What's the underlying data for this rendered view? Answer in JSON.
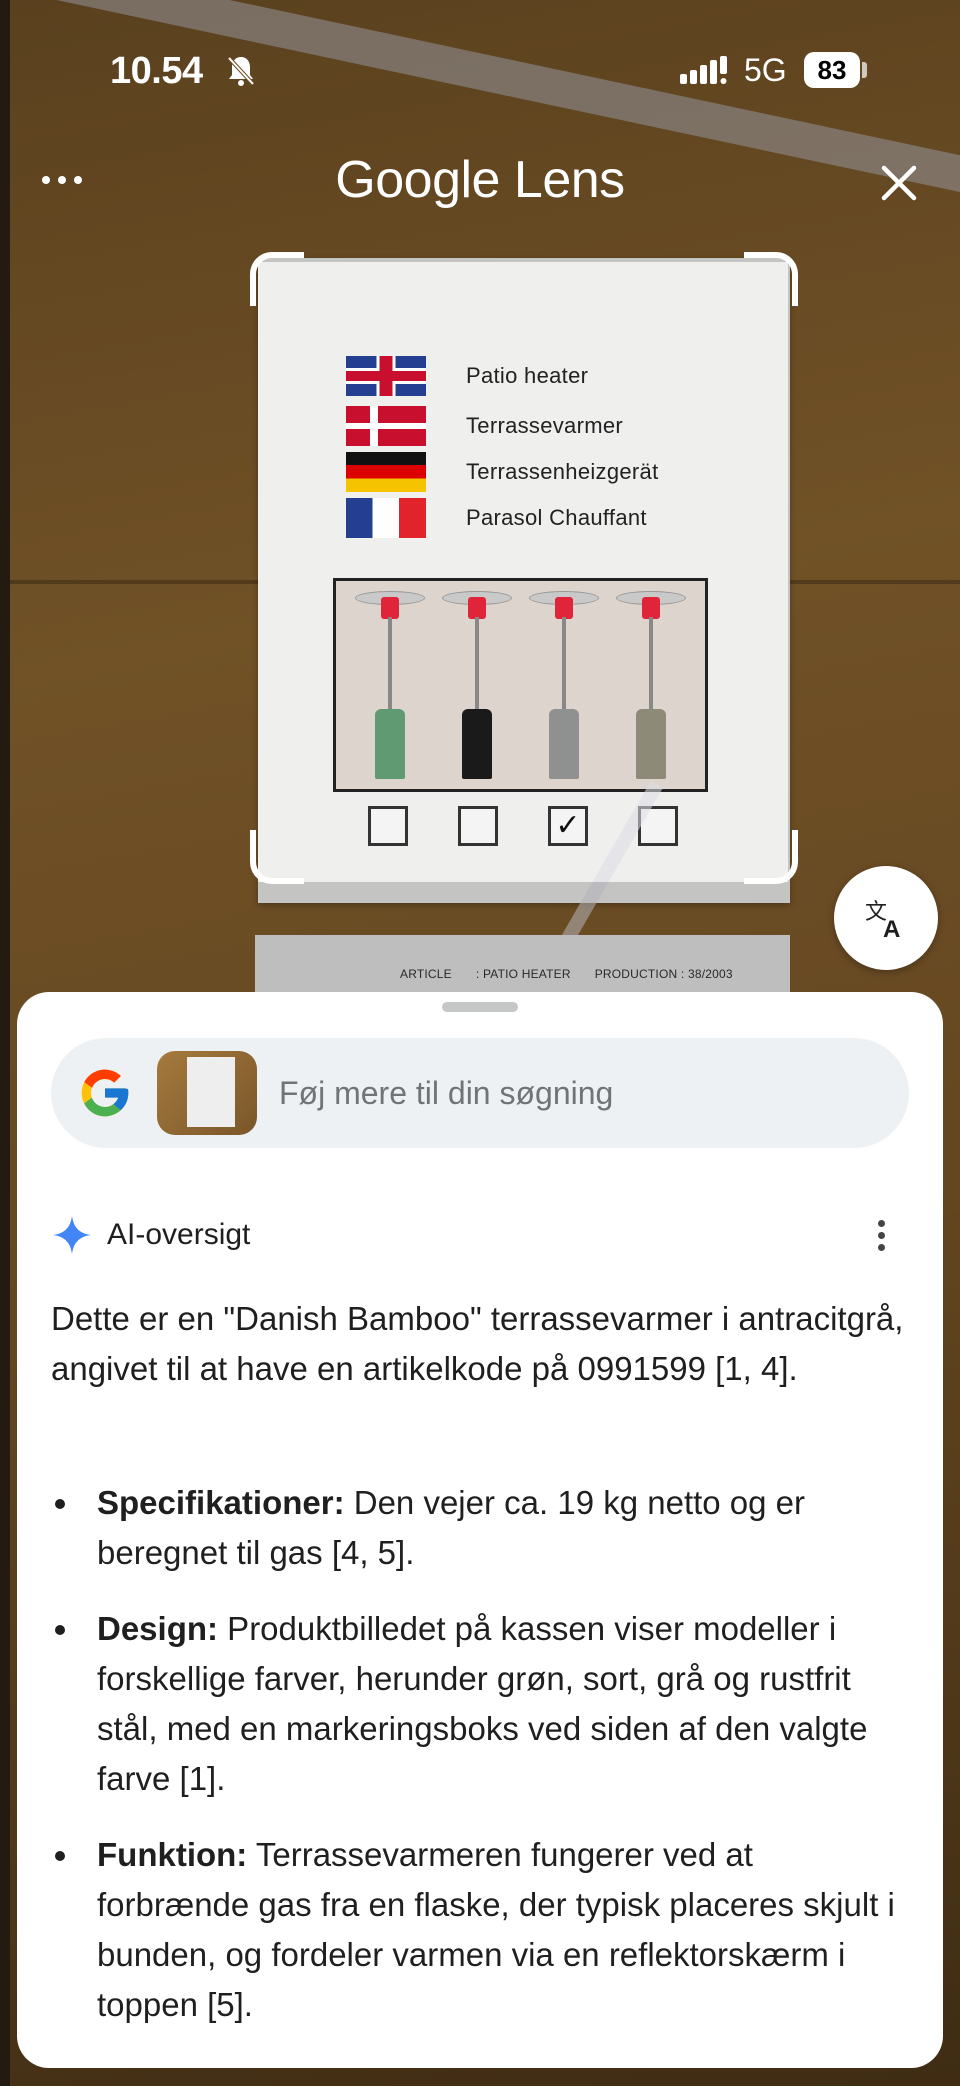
{
  "status_bar": {
    "time": "10.54",
    "network": "5G",
    "battery": "83"
  },
  "header": {
    "title": "Google Lens"
  },
  "camera": {
    "label_lines": [
      "Patio heater",
      "Terrassevarmer",
      "Terrassenheizgerät",
      "Parasol Chauffant"
    ],
    "heater_colors": [
      "#5f9a72",
      "#1a1a1a",
      "#8f9090",
      "#8e8a78"
    ],
    "checked_index": 2,
    "check_glyph": "✓",
    "article_text": [
      "ARTICLE",
      ": PATIO HEATER",
      "PRODUCTION : 38/2003"
    ]
  },
  "search": {
    "placeholder": "Føj mere til din søgning"
  },
  "ai_overview": {
    "title": "AI-oversigt",
    "intro": "Dette er en \"Danish Bamboo\" terrassevarmer i antracitgrå, angivet til at have en artikelkode på 0991599 [1, 4].",
    "bullets": [
      {
        "label": "Specifikationer:",
        "text": " Den vejer ca. 19 kg netto og er beregnet til gas [4, 5]."
      },
      {
        "label": "Design:",
        "text": " Produktbilledet på kassen viser modeller i forskellige farver, herunder grøn, sort, grå og rustfrit stål, med en markeringsboks ved siden af den valgte farve [1]."
      },
      {
        "label": "Funktion:",
        "text": " Terrassevarmeren fungerer ved at forbrænde gas fra en flaske, der typisk placeres skjult i bunden, og fordeler varmen via en reflektorskærm i toppen [5]."
      }
    ]
  },
  "icons": {
    "bell": "bell-off-icon",
    "signal": "signal-icon",
    "more": "more-horizontal-icon",
    "close": "close-icon",
    "translate": "translate-icon",
    "google": "google-g-icon",
    "sparkle": "ai-sparkle-icon",
    "kebab": "more-vertical-icon"
  },
  "colors": {
    "ai_sparkle": "#4285f4",
    "sheet_bg": "#ffffff",
    "search_bg": "#eef1f3"
  }
}
